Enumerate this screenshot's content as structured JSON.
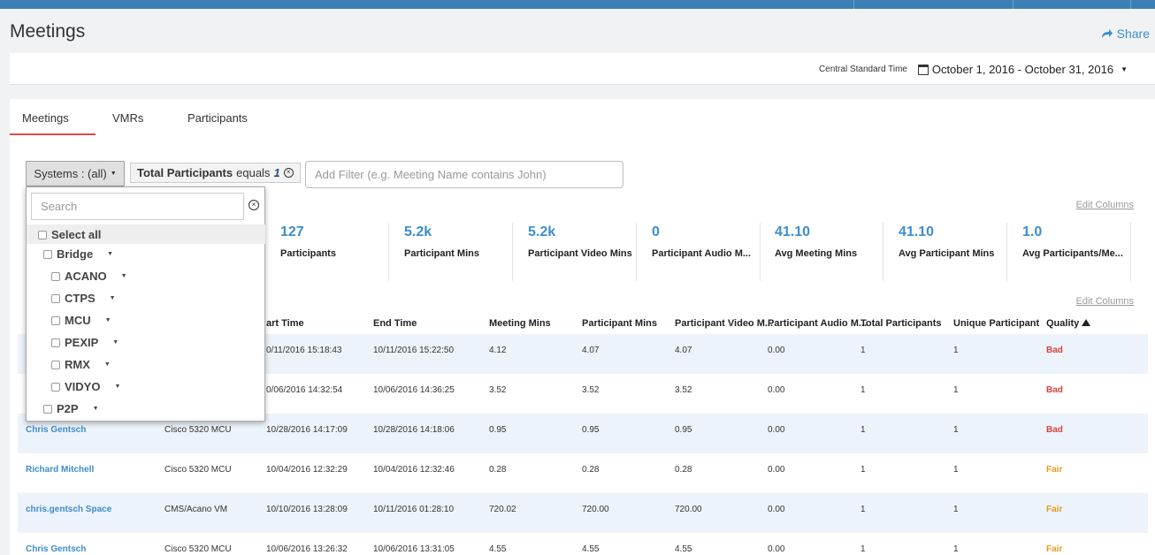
{
  "page": {
    "title": "Meetings",
    "share_label": "Share"
  },
  "datebar": {
    "timezone": "Central Standard Time",
    "range": "October 1, 2016 - October 31, 2016"
  },
  "tabs": [
    {
      "label": "Meetings",
      "active": true
    },
    {
      "label": "VMRs",
      "active": false
    },
    {
      "label": "Participants",
      "active": false
    }
  ],
  "filters": {
    "systems_label": "Systems : (all)",
    "chip_field": "Total Participants",
    "chip_op": "equals",
    "chip_value": "1",
    "add_placeholder": "Add Filter (e.g. Meeting Name contains John)"
  },
  "edit_columns_label": "Edit Columns",
  "stats": [
    {
      "value": "127",
      "label": "Participants"
    },
    {
      "value": "5.2k",
      "label": "Participant Mins"
    },
    {
      "value": "5.2k",
      "label": "Participant Video Mins"
    },
    {
      "value": "0",
      "label": "Participant Audio M..."
    },
    {
      "value": "41.10",
      "label": "Avg Meeting Mins"
    },
    {
      "value": "41.10",
      "label": "Avg Participant Mins"
    },
    {
      "value": "1.0",
      "label": "Avg Participants/Me..."
    }
  ],
  "table": {
    "headers": [
      "art Time",
      "End Time",
      "Meeting Mins",
      "Participant Mins",
      "Participant Video M...",
      "Participant Audio M...",
      "Total Participants",
      "Unique Participant",
      "Quality"
    ],
    "rows": [
      {
        "name": "",
        "system": "",
        "start": "0/11/2016 15:18:43",
        "end": "10/11/2016 15:22:50",
        "meeting_mins": "4.12",
        "part_mins": "4.07",
        "video": "4.07",
        "audio": "0.00",
        "total": "1",
        "unique": "1",
        "quality": "Bad"
      },
      {
        "name": "",
        "system": "",
        "start": "0/06/2016 14:32:54",
        "end": "10/06/2016 14:36:25",
        "meeting_mins": "3.52",
        "part_mins": "3.52",
        "video": "3.52",
        "audio": "0.00",
        "total": "1",
        "unique": "1",
        "quality": "Bad"
      },
      {
        "name": "Chris Gentsch",
        "system": "Cisco 5320 MCU",
        "start": "10/28/2016 14:17:09",
        "end": "10/28/2016 14:18:06",
        "meeting_mins": "0.95",
        "part_mins": "0.95",
        "video": "0.95",
        "audio": "0.00",
        "total": "1",
        "unique": "1",
        "quality": "Bad"
      },
      {
        "name": "Richard Mitchell",
        "system": "Cisco 5320 MCU",
        "start": "10/04/2016 12:32:29",
        "end": "10/04/2016 12:32:46",
        "meeting_mins": "0.28",
        "part_mins": "0.28",
        "video": "0.28",
        "audio": "0.00",
        "total": "1",
        "unique": "1",
        "quality": "Fair"
      },
      {
        "name": "chris.gentsch Space",
        "system": "CMS/Acano VM",
        "start": "10/10/2016 13:28:09",
        "end": "10/11/2016 01:28:10",
        "meeting_mins": "720.02",
        "part_mins": "720.00",
        "video": "720.00",
        "audio": "0.00",
        "total": "1",
        "unique": "1",
        "quality": "Fair"
      },
      {
        "name": "Chris Gentsch",
        "system": "Cisco 5320 MCU",
        "start": "10/06/2016 13:26:32",
        "end": "10/06/2016 13:31:05",
        "meeting_mins": "4.55",
        "part_mins": "4.55",
        "video": "4.55",
        "audio": "0.00",
        "total": "1",
        "unique": "1",
        "quality": "Fair"
      }
    ]
  },
  "dropdown": {
    "search_placeholder": "Search",
    "select_all": "Select all",
    "items": [
      {
        "label": "Bridge",
        "level": 0
      },
      {
        "label": "ACANO",
        "level": 1
      },
      {
        "label": "CTPS",
        "level": 1
      },
      {
        "label": "MCU",
        "level": 1
      },
      {
        "label": "PEXIP",
        "level": 1
      },
      {
        "label": "RMX",
        "level": 1
      },
      {
        "label": "VIDYO",
        "level": 1
      },
      {
        "label": "P2P",
        "level": 0
      }
    ]
  },
  "colors": {
    "accent": "#3c8dce",
    "bad": "#d9413a",
    "fair": "#e89a1e",
    "tab_active": "#e34b4b",
    "topbar": "#3d7fb5"
  }
}
